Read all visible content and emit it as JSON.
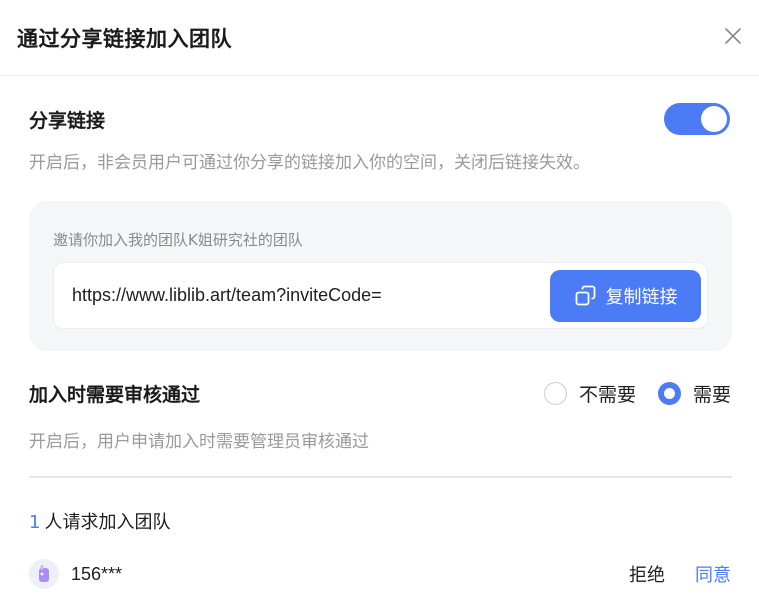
{
  "dialog": {
    "title": "通过分享链接加入团队"
  },
  "share": {
    "title": "分享链接",
    "enabled": true,
    "description": "开启后，非会员用户可通过你分享的链接加入你的空间，关闭后链接失效。",
    "invite_text": "邀请你加入我的团队K姐研究社的团队",
    "url": "https://www.liblib.art/team?inviteCode=",
    "copy_label": "复制链接"
  },
  "review": {
    "title": "加入时需要审核通过",
    "options": [
      {
        "label": "不需要",
        "selected": false
      },
      {
        "label": "需要",
        "selected": true
      }
    ],
    "description": "开启后，用户申请加入时需要管理员审核通过"
  },
  "requests": {
    "count": "1",
    "count_label": "人请求加入团队",
    "items": [
      {
        "username": "156***",
        "reject_label": "拒绝",
        "approve_label": "同意"
      }
    ]
  },
  "colors": {
    "accent": "#4b7bf5",
    "muted_text": "#9a9a9a",
    "card_bg": "#f5f6f8"
  }
}
